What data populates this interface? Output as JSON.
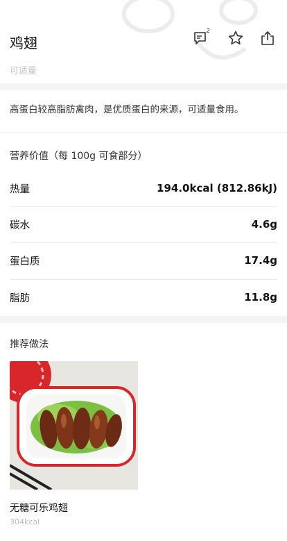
{
  "header": {
    "title": "鸡翅",
    "hint": "可适量",
    "comment_badge": "2"
  },
  "description": "高蛋白较高脂肪禽肉，是优质蛋白的来源，可适量食用。",
  "nutrition": {
    "title": "营养价值（每 100g 可食部分）",
    "rows": [
      {
        "label": "热量",
        "value": "194.0kcal (812.86kJ)"
      },
      {
        "label": "碳水",
        "value": "4.6g"
      },
      {
        "label": "蛋白质",
        "value": "17.4g"
      },
      {
        "label": "脂肪",
        "value": "11.8g"
      }
    ]
  },
  "recipes": {
    "title": "推荐做法",
    "items": [
      {
        "name": "无糖可乐鸡翅",
        "kcal": "304kcal"
      }
    ]
  }
}
